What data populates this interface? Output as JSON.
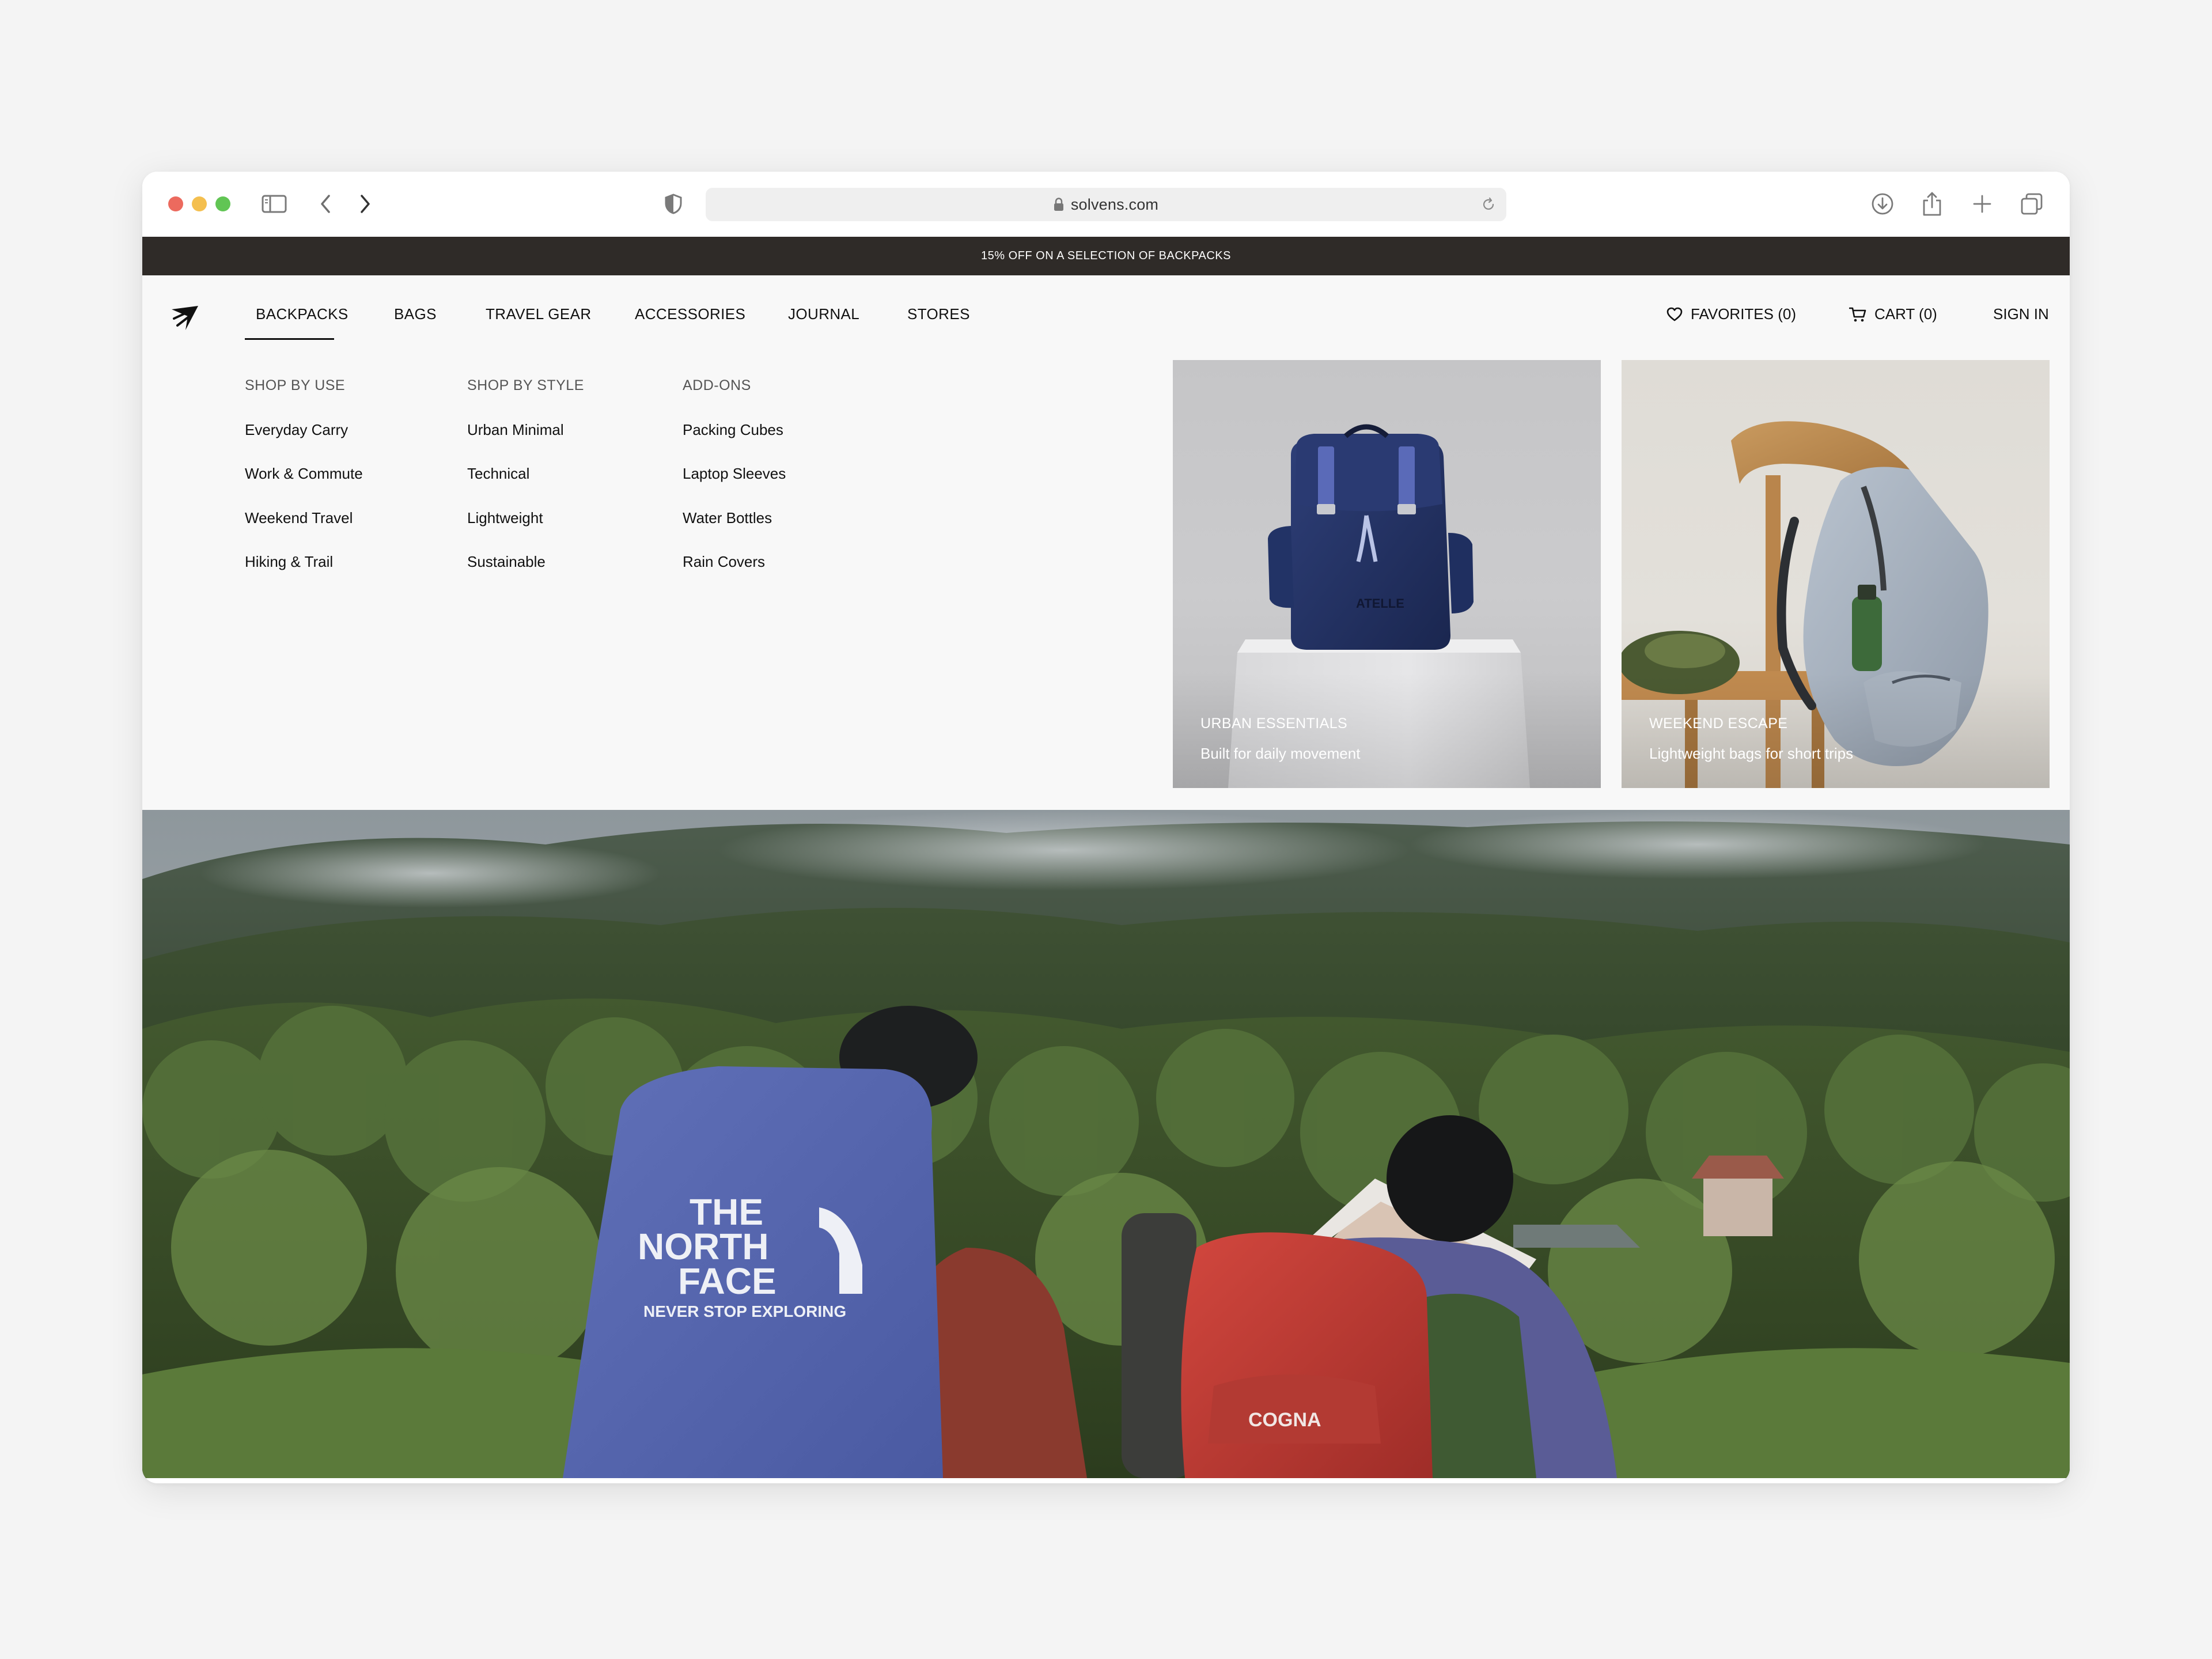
{
  "browser": {
    "url": "solvens.com",
    "icons": [
      "sidebar-icon",
      "back-icon",
      "forward-icon",
      "shield-icon",
      "lock-icon",
      "reload-icon",
      "download-icon",
      "share-icon",
      "new-tab-icon",
      "tabs-overview-icon"
    ]
  },
  "promo": {
    "text": "15% OFF ON A SELECTION OF BACKPACKS"
  },
  "nav": {
    "items": [
      {
        "label": "BACKPACKS",
        "active": true
      },
      {
        "label": "BAGS"
      },
      {
        "label": "TRAVEL GEAR"
      },
      {
        "label": "ACCESSORIES"
      },
      {
        "label": "JOURNAL"
      },
      {
        "label": "STORES"
      }
    ],
    "favorites": "FAVORITES (0)",
    "cart": "CART (0)",
    "signin": "SIGN IN"
  },
  "menu": {
    "columns": [
      {
        "heading": "SHOP BY USE",
        "links": [
          "Everyday Carry",
          "Work & Commute",
          "Weekend Travel",
          "Hiking & Trail"
        ]
      },
      {
        "heading": "SHOP BY STYLE",
        "links": [
          "Urban Minimal",
          "Technical",
          "Lightweight",
          "Sustainable"
        ]
      },
      {
        "heading": "ADD-ONS",
        "links": [
          "Packing Cubes",
          "Laptop Sleeves",
          "Water Bottles",
          "Rain Covers"
        ]
      }
    ]
  },
  "cards": [
    {
      "title": "URBAN ESSENTIALS",
      "subtitle": "Built for daily movement"
    },
    {
      "title": "WEEKEND ESCAPE",
      "subtitle": "Lightweight bags for short trips"
    }
  ],
  "hero": {
    "print": {
      "line1": "THE",
      "line2": "NORTH",
      "line3": "FACE",
      "tagline": "NEVER STOP EXPLORING",
      "pack2": "COGNA"
    }
  },
  "colors": {
    "promo_bg": "#2f2b28",
    "menu_bg": "#f8f8f8",
    "text": "#111111",
    "traffic_red": "#ec6a5e",
    "traffic_yellow": "#f4bf4f",
    "traffic_green": "#61c554"
  }
}
